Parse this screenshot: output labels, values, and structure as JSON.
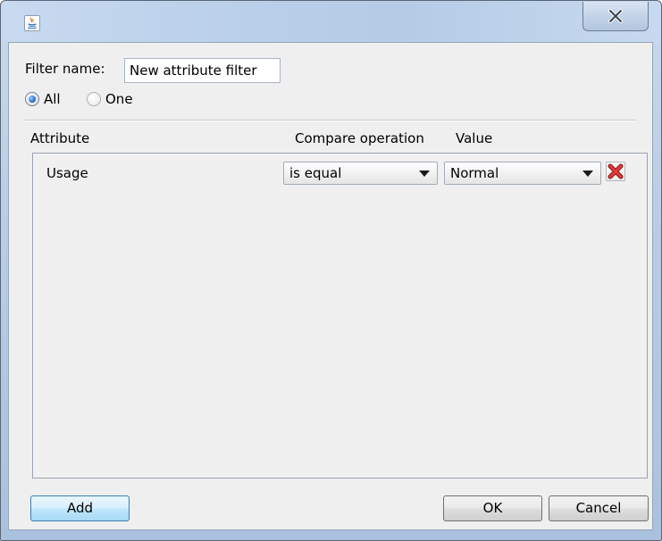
{
  "window": {
    "close_glyph": "X"
  },
  "filter": {
    "name_label": "Filter name:",
    "name_value": "New attribute filter",
    "match_options": [
      {
        "label": "All",
        "checked": true
      },
      {
        "label": "One",
        "checked": false
      }
    ]
  },
  "table": {
    "headers": {
      "attribute": "Attribute",
      "compare": "Compare operation",
      "value": "Value"
    },
    "rows": [
      {
        "attribute": "Usage",
        "compare": "is equal",
        "value": "Normal"
      }
    ]
  },
  "buttons": {
    "add": "Add",
    "ok": "OK",
    "cancel": "Cancel"
  },
  "colors": {
    "title_bar": "#bcd1ea",
    "client_background": "#efefef",
    "default_button": "#bee6fd",
    "remove_icon": "#d42a2a"
  }
}
